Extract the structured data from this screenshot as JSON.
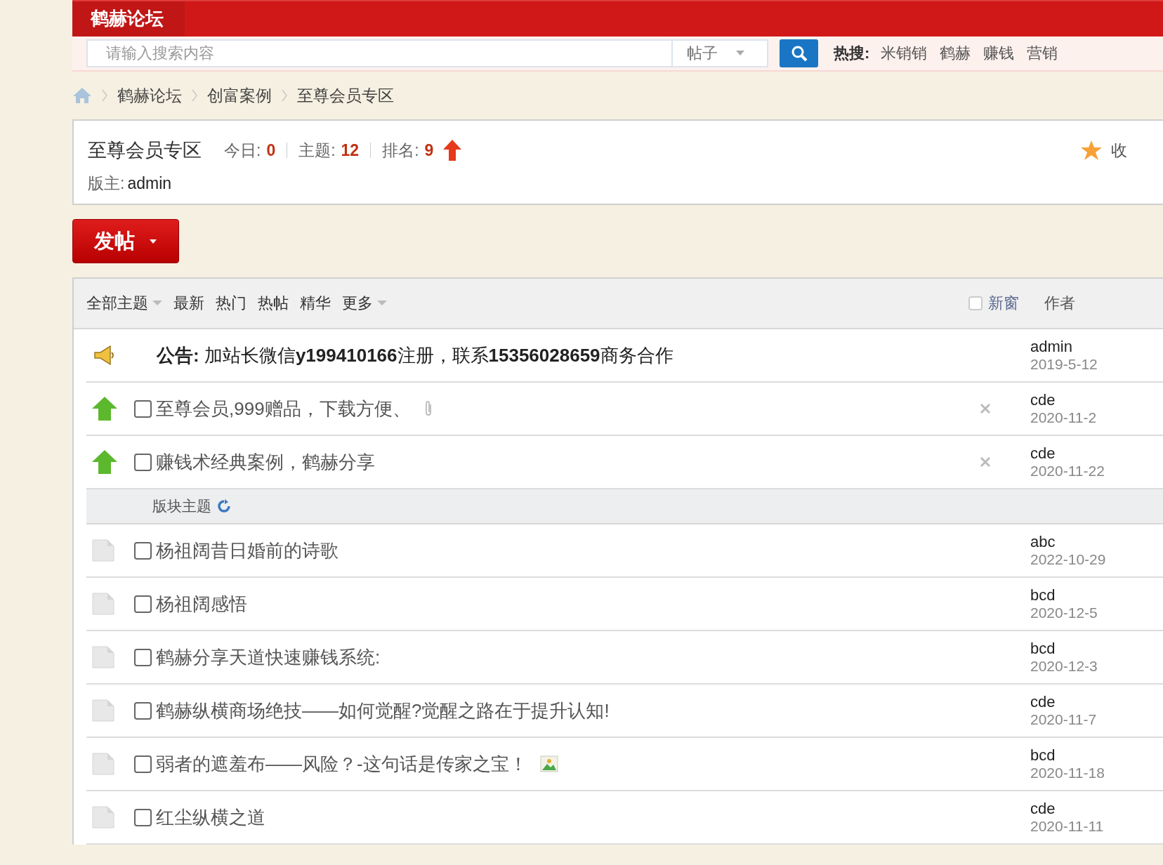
{
  "header": {
    "logo": "鹤赫论坛",
    "search": {
      "placeholder": "请输入搜索内容",
      "scope": "帖子"
    },
    "hot_label": "热搜:",
    "hot_terms": [
      "米销销",
      "鹤赫",
      "赚钱",
      "营销"
    ]
  },
  "breadcrumb": [
    "鹤赫论坛",
    "创富案例",
    "至尊会员专区"
  ],
  "forum": {
    "title": "至尊会员专区",
    "stats": [
      {
        "label": "今日:",
        "value": "0"
      },
      {
        "label": "主题:",
        "value": "12"
      },
      {
        "label": "排名:",
        "value": "9"
      }
    ],
    "moderator_label": "版主:",
    "moderator": "admin",
    "favorite": "收"
  },
  "post_button": "发帖",
  "filters": [
    {
      "label": "全部主题",
      "dropdown": true
    },
    {
      "label": "最新",
      "dropdown": false
    },
    {
      "label": "热门",
      "dropdown": false
    },
    {
      "label": "热帖",
      "dropdown": false
    },
    {
      "label": "精华",
      "dropdown": false
    },
    {
      "label": "更多",
      "dropdown": true
    }
  ],
  "new_window": {
    "label": "新窗",
    "checked": false
  },
  "author_header": "作者",
  "threads": [
    {
      "kind": "announcement",
      "title": "**公告:** 加站长微信**y199410166**注册，联系**15356028659**商务合作",
      "author": "admin",
      "date": "2019-5-12"
    },
    {
      "kind": "sticky",
      "checked": false,
      "title": "至尊会员,999赠品，下载方便、",
      "attachment": true,
      "image": false,
      "author": "cde",
      "date": "2020-11-2"
    },
    {
      "kind": "sticky",
      "checked": false,
      "title": "赚钱术经典案例，鹤赫分享",
      "attachment": false,
      "image": false,
      "author": "cde",
      "date": "2020-11-22"
    },
    {
      "kind": "section",
      "title": "版块主题"
    },
    {
      "kind": "normal",
      "checked": false,
      "title": "杨祖阔昔日婚前的诗歌",
      "attachment": false,
      "image": false,
      "author": "abc",
      "date": "2022-10-29"
    },
    {
      "kind": "normal",
      "checked": false,
      "title": "杨祖阔感悟",
      "attachment": false,
      "image": false,
      "author": "bcd",
      "date": "2020-12-5"
    },
    {
      "kind": "normal",
      "checked": false,
      "title": "鹤赫分享天道快速赚钱系统:",
      "attachment": false,
      "image": false,
      "author": "bcd",
      "date": "2020-12-3"
    },
    {
      "kind": "normal",
      "checked": false,
      "title": "鹤赫纵横商场绝技——如何觉醒?觉醒之路在于提升认知!",
      "attachment": false,
      "image": false,
      "author": "cde",
      "date": "2020-11-7"
    },
    {
      "kind": "normal",
      "checked": false,
      "title": "弱者的遮羞布——风险？-这句话是传家之宝！",
      "attachment": false,
      "image": true,
      "author": "bcd",
      "date": "2020-11-18"
    },
    {
      "kind": "normal",
      "checked": false,
      "title": "红尘纵横之道",
      "attachment": false,
      "image": false,
      "author": "cde",
      "date": "2020-11-11"
    }
  ]
}
